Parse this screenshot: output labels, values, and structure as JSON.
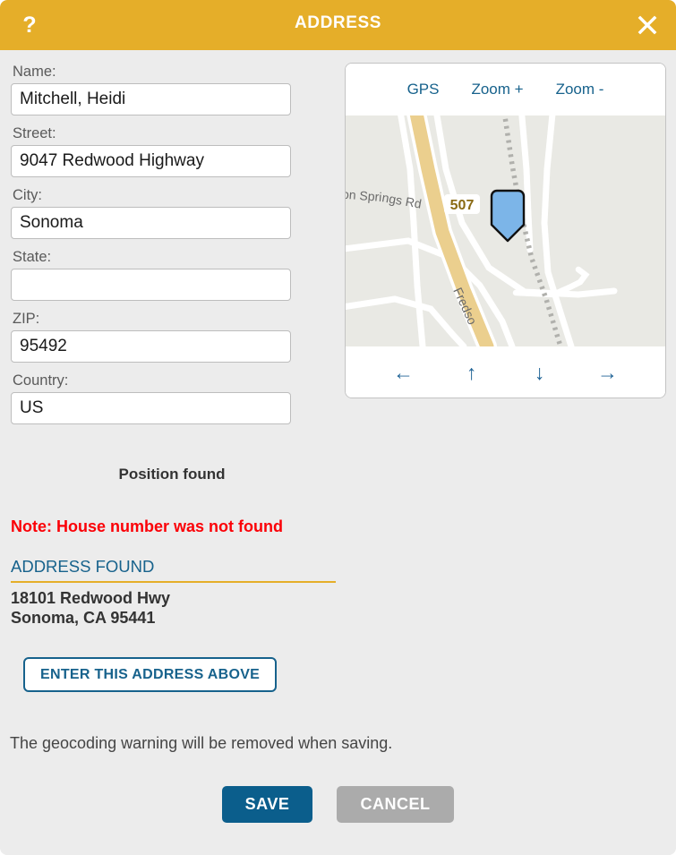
{
  "titlebar": {
    "help_label": "?",
    "title": "ADDRESS",
    "close_label": "✕"
  },
  "form": {
    "fields": [
      {
        "label": "Name:",
        "value": "Mitchell, Heidi",
        "placeholder": ""
      },
      {
        "label": "Street:",
        "value": "9047 Redwood Highway",
        "placeholder": ""
      },
      {
        "label": "City:",
        "value": "Sonoma",
        "placeholder": ""
      },
      {
        "label": "State:",
        "value": "",
        "placeholder": ""
      },
      {
        "label": "ZIP:",
        "value": "95492",
        "placeholder": ""
      },
      {
        "label": "Country:",
        "value": "US",
        "placeholder": ""
      }
    ]
  },
  "map": {
    "toolbar": [
      {
        "label": "GPS",
        "name": "gps-button"
      },
      {
        "label": "Zoom +",
        "name": "zoom-in-button"
      },
      {
        "label": "Zoom -",
        "name": "zoom-out-button"
      }
    ],
    "nav": [
      {
        "label": "←",
        "name": "pan-left-button"
      },
      {
        "label": "↑",
        "name": "pan-up-button"
      },
      {
        "label": "↓",
        "name": "pan-down-button"
      },
      {
        "label": "→",
        "name": "pan-right-button"
      }
    ],
    "labels": {
      "road_shield": "507",
      "street_1": "tton Springs Rd",
      "street_2": "Fredso"
    },
    "marker_color": "#7cb5e8"
  },
  "status": {
    "position_found": "Position found",
    "note": "Note: House number was not found",
    "found_heading": "ADDRESS FOUND",
    "found_line1": "18101 Redwood Hwy",
    "found_line2": "Sonoma, CA 95441",
    "enter_address_label": "ENTER THIS ADDRESS ABOVE",
    "geocoding_hint": "The geocoding warning will be removed when saving."
  },
  "footer": {
    "save_label": "SAVE",
    "cancel_label": "CANCEL"
  },
  "colors": {
    "header": "#e5ae29",
    "accent_blue": "#17628c",
    "save_blue": "#0b5e8c",
    "cancel_gray": "#ababab",
    "error_red": "#fb0007",
    "background": "#ececec"
  }
}
